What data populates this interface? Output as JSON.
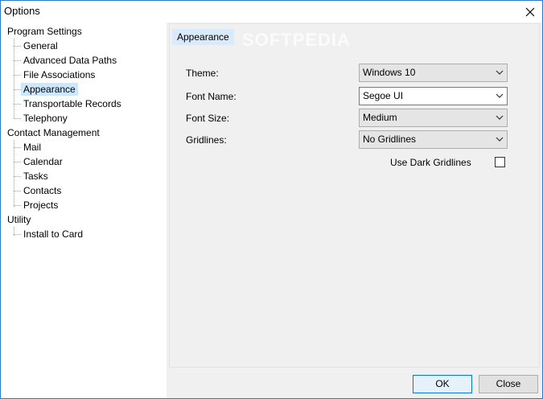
{
  "window": {
    "title": "Options"
  },
  "tree": {
    "groups": [
      {
        "label": "Program Settings",
        "children": [
          "General",
          "Advanced Data Paths",
          "File Associations",
          "Appearance",
          "Transportable Records",
          "Telephony"
        ]
      },
      {
        "label": "Contact Management",
        "children": [
          "Mail",
          "Calendar",
          "Tasks",
          "Contacts",
          "Projects"
        ]
      },
      {
        "label": "Utility",
        "children": [
          "Install to Card"
        ]
      }
    ],
    "selected": "Appearance"
  },
  "panel": {
    "heading": "Appearance",
    "watermark": "SOFTPEDIA",
    "fields": {
      "theme": {
        "label": "Theme:",
        "value": "Windows 10"
      },
      "font_name": {
        "label": "Font Name:",
        "value": "Segoe UI"
      },
      "font_size": {
        "label": "Font Size:",
        "value": "Medium"
      },
      "gridlines": {
        "label": "Gridlines:",
        "value": "No Gridlines"
      }
    },
    "dark_gridlines": {
      "label": "Use Dark Gridlines",
      "checked": false
    }
  },
  "buttons": {
    "ok": "OK",
    "close": "Close"
  },
  "icons": {
    "close": "close-icon",
    "dropdown": "chevron-down-icon"
  },
  "colors": {
    "selection": "#cce8ff",
    "accent": "#0078d7"
  }
}
